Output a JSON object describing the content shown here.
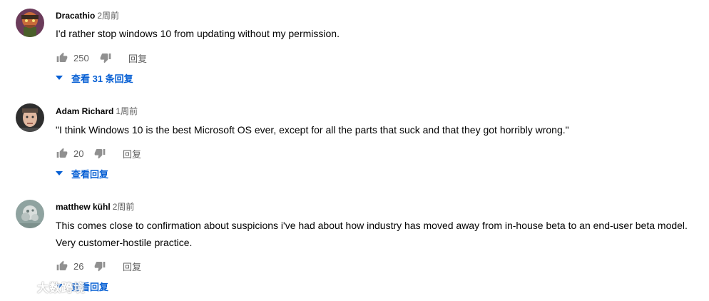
{
  "comments": [
    {
      "author": "Dracathio",
      "time": "2周前",
      "text": "I'd rather stop windows 10 from updating without my permission.",
      "likes": "250",
      "reply_label": "回复",
      "replies_label": "查看 31 条回复"
    },
    {
      "author": "Adam Richard",
      "time": "1周前",
      "text": "\"I think Windows 10 is the best Microsoft OS ever, except for all the parts that suck and that they got horribly wrong.\"",
      "likes": "20",
      "reply_label": "回复",
      "replies_label": "查看回复"
    },
    {
      "author": "matthew kühl",
      "time": "2周前",
      "text": "This comes close to confirmation about suspicions i've had about how industry has moved away from in-house beta to an end-user beta model. Very customer-hostile practice.",
      "likes": "26",
      "reply_label": "回复",
      "replies_label": "查看回复"
    }
  ],
  "watermark": "大数跨境",
  "colors": {
    "link_blue": "#065fd4",
    "meta_gray": "#606060",
    "text": "#030303"
  },
  "icons": [
    "thumb-up-icon",
    "thumb-down-icon",
    "caret-down-icon"
  ]
}
